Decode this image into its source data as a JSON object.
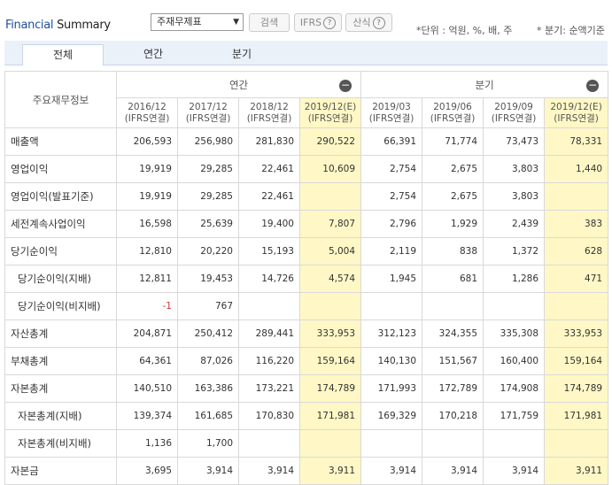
{
  "header": {
    "title_left": "Financial",
    "title_right": " Summary",
    "select_value": "주재무제표",
    "search_label": "검색",
    "ifrs_label": "IFRS",
    "formula_label": "산식",
    "unit_text": "*단위 : 억원, %, 배, 주",
    "period_text": "* 분기: 순액기준"
  },
  "tabs": [
    "전체",
    "연간",
    "분기"
  ],
  "table": {
    "item_header": "주요재무정보",
    "annual_header": "연간",
    "quarter_header": "분기",
    "columns": [
      {
        "period": "2016/12",
        "basis": "(IFRS연결)"
      },
      {
        "period": "2017/12",
        "basis": "(IFRS연결)"
      },
      {
        "period": "2018/12",
        "basis": "(IFRS연결)"
      },
      {
        "period": "2019/12(E)",
        "basis": "(IFRS연결)"
      },
      {
        "period": "2019/03",
        "basis": "(IFRS연결)"
      },
      {
        "period": "2019/06",
        "basis": "(IFRS연결)"
      },
      {
        "period": "2019/09",
        "basis": "(IFRS연결)"
      },
      {
        "period": "2019/12(E)",
        "basis": "(IFRS연결)"
      }
    ],
    "rows": [
      {
        "label": "매출액",
        "indent": false,
        "values": [
          "206,593",
          "256,980",
          "281,830",
          "290,522",
          "66,391",
          "71,774",
          "73,473",
          "78,331"
        ]
      },
      {
        "label": "영업이익",
        "indent": false,
        "values": [
          "19,919",
          "29,285",
          "22,461",
          "10,609",
          "2,754",
          "2,675",
          "3,803",
          "1,440"
        ]
      },
      {
        "label": "영업이익(발표기준)",
        "indent": false,
        "values": [
          "19,919",
          "29,285",
          "22,461",
          "",
          "2,754",
          "2,675",
          "3,803",
          ""
        ]
      },
      {
        "label": "세전계속사업이익",
        "indent": false,
        "values": [
          "16,598",
          "25,639",
          "19,400",
          "7,807",
          "2,796",
          "1,929",
          "2,439",
          "383"
        ]
      },
      {
        "label": "당기순이익",
        "indent": false,
        "values": [
          "12,810",
          "20,220",
          "15,193",
          "5,004",
          "2,119",
          "838",
          "1,372",
          "628"
        ]
      },
      {
        "label": "당기순이익(지배)",
        "indent": true,
        "values": [
          "12,811",
          "19,453",
          "14,726",
          "4,574",
          "1,945",
          "681",
          "1,286",
          "471"
        ]
      },
      {
        "label": "당기순이익(비지배)",
        "indent": true,
        "values": [
          "-1",
          "767",
          "",
          "",
          "",
          "",
          "",
          ""
        ]
      },
      {
        "label": "자산총계",
        "indent": false,
        "values": [
          "204,871",
          "250,412",
          "289,441",
          "333,953",
          "312,123",
          "324,355",
          "335,308",
          "333,953"
        ]
      },
      {
        "label": "부채총계",
        "indent": false,
        "values": [
          "64,361",
          "87,026",
          "116,220",
          "159,164",
          "140,130",
          "151,567",
          "160,400",
          "159,164"
        ]
      },
      {
        "label": "자본총계",
        "indent": false,
        "values": [
          "140,510",
          "163,386",
          "173,221",
          "174,789",
          "171,993",
          "172,789",
          "174,908",
          "174,789"
        ]
      },
      {
        "label": "자본총계(지배)",
        "indent": true,
        "values": [
          "139,374",
          "161,685",
          "170,830",
          "171,981",
          "169,329",
          "170,218",
          "171,759",
          "171,981"
        ]
      },
      {
        "label": "자본총계(비지배)",
        "indent": true,
        "values": [
          "1,136",
          "1,700",
          "",
          "",
          "",
          "",
          "",
          ""
        ]
      },
      {
        "label": "자본금",
        "indent": false,
        "values": [
          "3,695",
          "3,914",
          "3,914",
          "3,911",
          "3,914",
          "3,914",
          "3,914",
          "3,911"
        ]
      }
    ]
  }
}
